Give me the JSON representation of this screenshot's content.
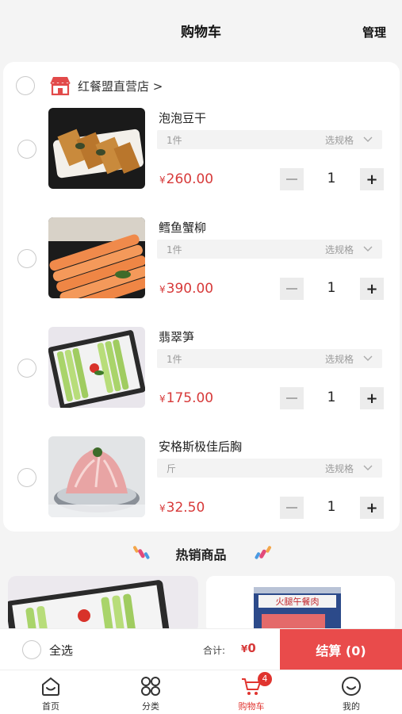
{
  "header": {
    "title": "购物车",
    "manage_label": "管理"
  },
  "store": {
    "name": "红餐盟直营店 >"
  },
  "items": [
    {
      "name": "泡泡豆干",
      "spec_value": "1件",
      "spec_pick": "选规格",
      "currency": "¥",
      "price": "260.00",
      "qty": "1",
      "image": "dried-tofu-photo"
    },
    {
      "name": "鳕鱼蟹柳",
      "spec_value": "1件",
      "spec_pick": "选规格",
      "currency": "¥",
      "price": "390.00",
      "qty": "1",
      "image": "crab-stick-photo"
    },
    {
      "name": "翡翠笋",
      "spec_value": "1件",
      "spec_pick": "选规格",
      "currency": "¥",
      "price": "175.00",
      "qty": "1",
      "image": "bamboo-shoot-photo"
    },
    {
      "name": "安格斯极佳后胸",
      "spec_value": "斤",
      "spec_pick": "选规格",
      "currency": "¥",
      "price": "32.50",
      "qty": "1",
      "image": "angus-beef-photo"
    }
  ],
  "hot": {
    "title": "热销商品",
    "product_label_text": "火腿午餐肉"
  },
  "checkout": {
    "select_all_label": "全选",
    "total_label": "合计:",
    "currency": "¥",
    "total_value": "0",
    "button_label": "结算 (0)"
  },
  "tabbar": {
    "tabs": [
      {
        "label": "首页",
        "icon": "home-icon"
      },
      {
        "label": "分类",
        "icon": "category-icon"
      },
      {
        "label": "购物车",
        "icon": "cart-icon",
        "active": true,
        "badge": "4"
      },
      {
        "label": "我的",
        "icon": "profile-icon"
      }
    ]
  },
  "colors": {
    "accent": "#e94b4b",
    "price": "#d73a3a",
    "background": "#f4f4f4"
  }
}
